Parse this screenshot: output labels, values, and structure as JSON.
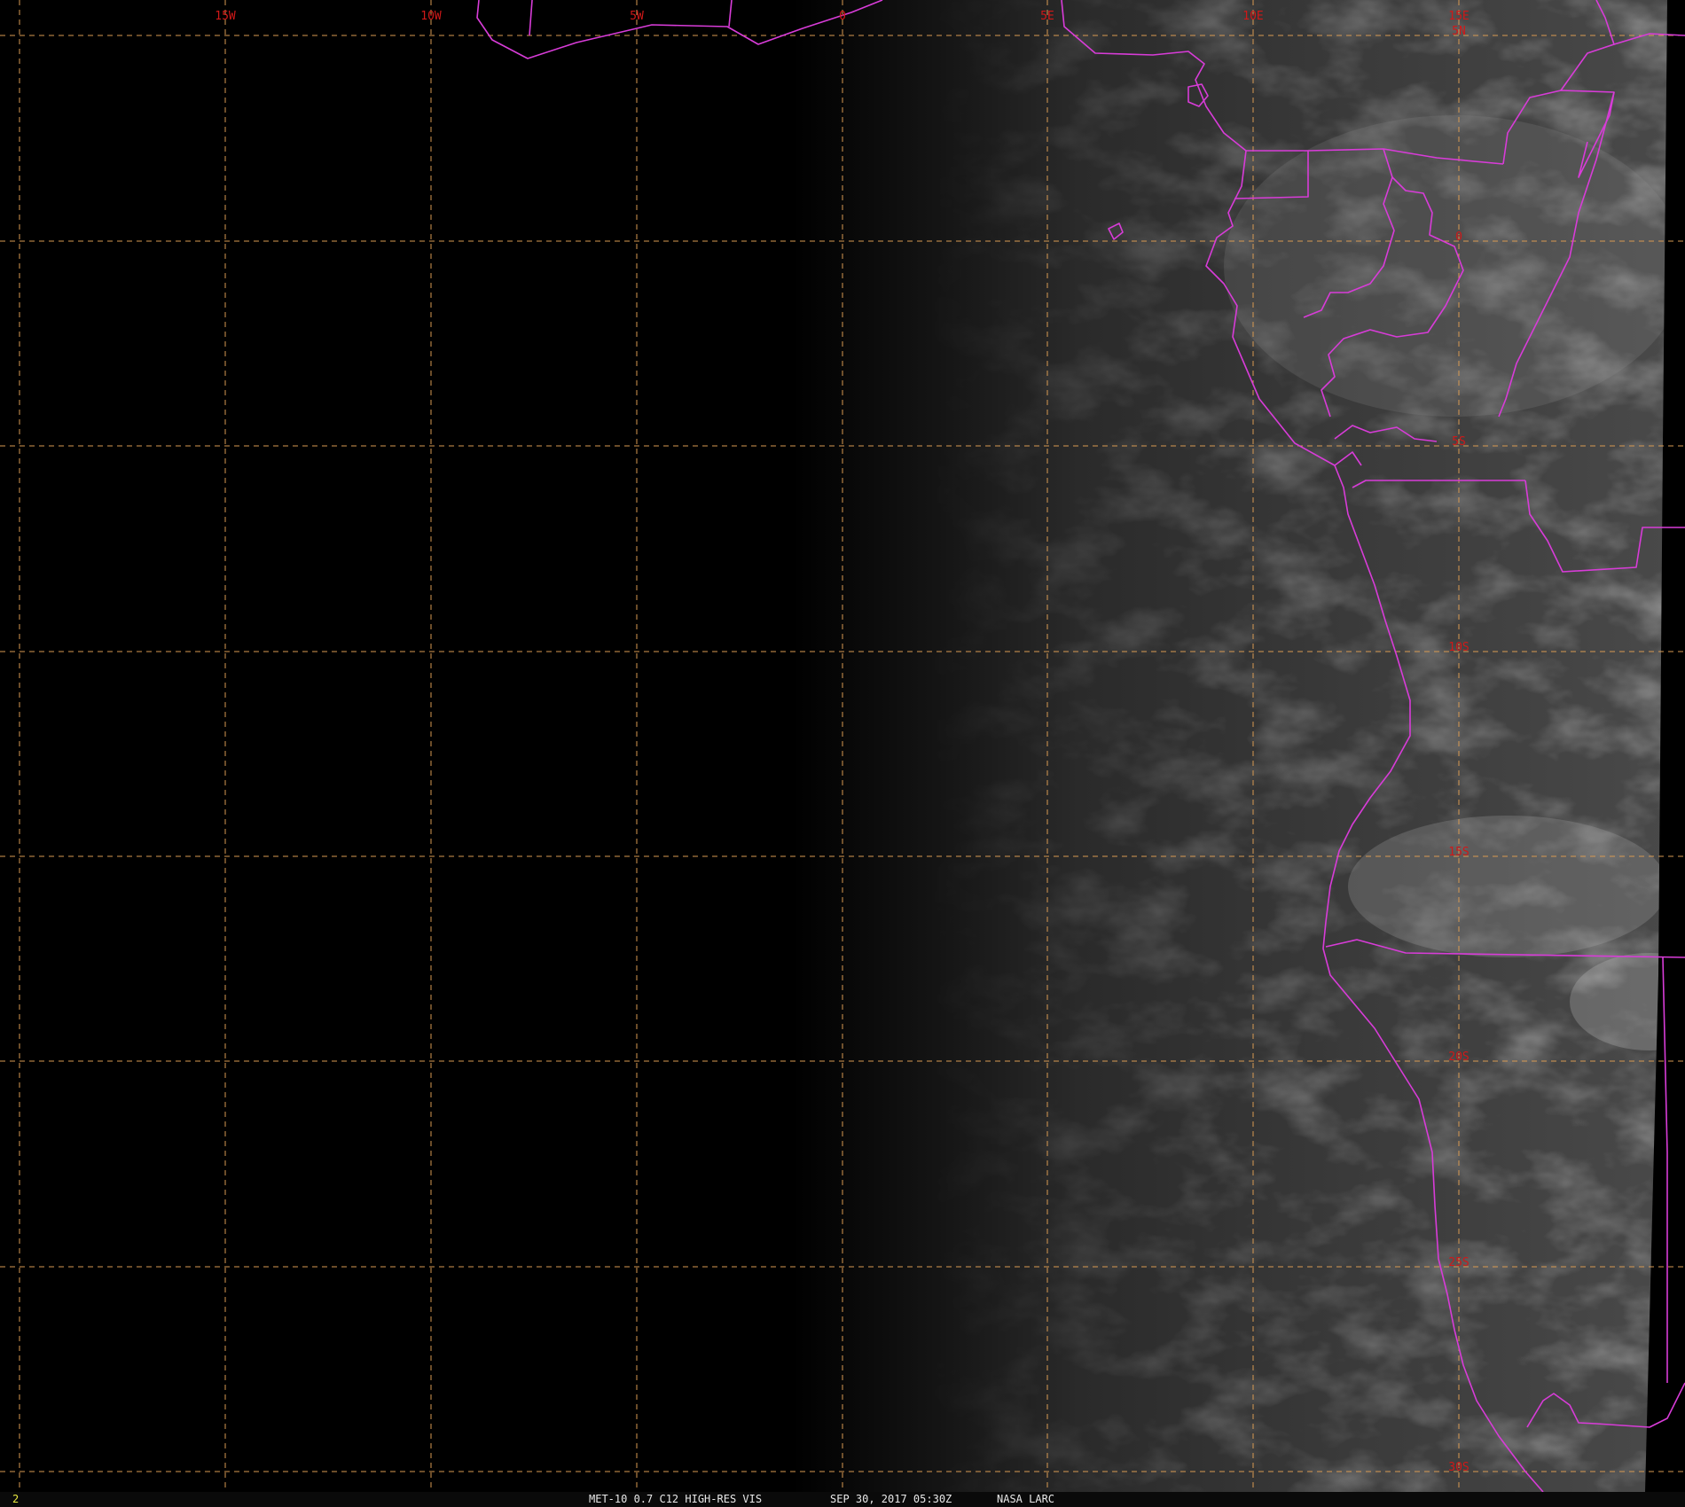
{
  "map": {
    "graticule_color": "#d89a52",
    "boundary_color": "#d83cd8",
    "label_color": "#d01818",
    "longitude_labels": [
      "15W",
      "10W",
      "5W",
      "0",
      "5E",
      "10E",
      "15E"
    ],
    "latitude_labels": [
      "5N",
      "0",
      "5S",
      "10S",
      "15S",
      "20S",
      "25S",
      "30S"
    ]
  },
  "status_bar": {
    "frame_number": "2",
    "product": "MET-10 0.7 C12 HIGH-RES VIS",
    "timestamp": "SEP 30, 2017 05:30Z",
    "credit": "NASA LARC"
  }
}
